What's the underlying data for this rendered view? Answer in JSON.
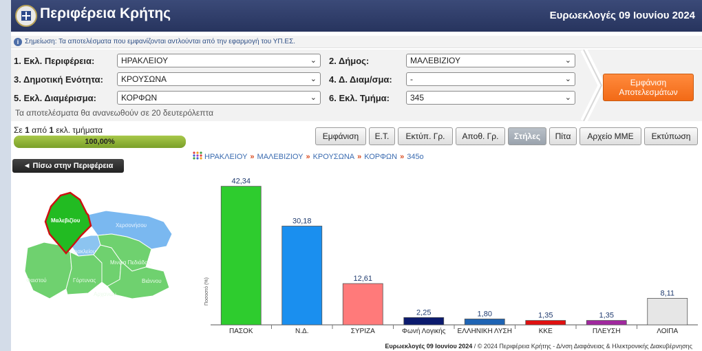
{
  "header": {
    "title": "Περιφέρεια Κρήτης",
    "election": "Ευρωεκλογές 09 Ιουνίου 2024"
  },
  "note": "Σημείωση: Τα αποτελέσματα που εμφανίζονται αντλούνται από την εφαρμογή του ΥΠ.ΕΣ.",
  "filters": [
    {
      "label": "1. Εκλ. Περιφέρεια:",
      "value": "ΗΡΑΚΛΕΙΟΥ"
    },
    {
      "label": "2. Δήμος:",
      "value": "ΜΑΛΕΒΙΖΙΟΥ"
    },
    {
      "label": "3. Δημοτική Ενότητα:",
      "value": "ΚΡΟΥΣΩΝΑ"
    },
    {
      "label": "4. Δ. Διαμ/σμα:",
      "value": "-"
    },
    {
      "label": "5. Εκλ. Διαμέρισμα:",
      "value": "ΚΟΡΦΩΝ"
    },
    {
      "label": "6. Εκλ. Τμήμα:",
      "value": "345"
    }
  ],
  "refresh_note": "Τα αποτελέσματα θα ανανεωθούν σε 20 δευτερόλεπτα",
  "show_results": {
    "line1": "Εμφάνιση",
    "line2": "Αποτελεσμάτων"
  },
  "progress": {
    "pre": "Σε ",
    "done": "1",
    "mid": " από ",
    "total": "1",
    "post": " εκλ. τμήματα",
    "percent_label": "100,00%",
    "fraction": 1.0
  },
  "toolbar": [
    {
      "label": "Εμφάνιση",
      "active": false
    },
    {
      "label": "Ε.Τ.",
      "active": false
    },
    {
      "label": "Εκτύπ. Γρ.",
      "active": false
    },
    {
      "label": "Αποθ. Γρ.",
      "active": false
    },
    {
      "label": "Στήλες",
      "active": true
    },
    {
      "label": "Πίτα",
      "active": false
    },
    {
      "label": "Αρχείο ΜΜΕ",
      "active": false
    },
    {
      "label": "Εκτύπωση",
      "active": false
    }
  ],
  "back_button": "◄ Πίσω στην Περιφέρεια",
  "breadcrumb": [
    "ΗΡΑΚΛΕΙΟΥ",
    "ΜΑΛΕΒΙΖΙΟΥ",
    "ΚΡΟΥΣΩΝΑ",
    "ΚΟΡΦΩΝ",
    "345ο"
  ],
  "map": {
    "selected": "Μαλεβιζίου",
    "regions": [
      "Χερσονήσου",
      "Ηρακλείου",
      "Μινώα Πεδιάδας",
      "Φαιστού",
      "Γόρτυνας",
      "Βιάννου",
      "Αρχανών"
    ],
    "colors": {
      "selected": "#22bb22",
      "selected_border": "#cc1111",
      "won": "#6fd16f",
      "other": "#7ab8f0"
    }
  },
  "chart_data": {
    "type": "bar",
    "ylabel": "Ποσοστό (%)",
    "categories": [
      "ΠΑΣΟΚ",
      "Ν.Δ.",
      "ΣΥΡΙΖΑ",
      "Φωνή Λογικής",
      "ΕΛΛΗΝΙΚΗ ΛΥΣΗ",
      "ΚΚΕ",
      "ΠΛΕΥΣΗ",
      "ΛΟΙΠΑ"
    ],
    "values": [
      42.34,
      30.18,
      12.61,
      2.25,
      1.8,
      1.35,
      1.35,
      8.11
    ],
    "value_labels": [
      "42,34",
      "30,18",
      "12,61",
      "2,25",
      "1,80",
      "1,35",
      "1,35",
      "8,11"
    ],
    "colors": [
      "#2ecc2e",
      "#1a8fef",
      "#ff7a7a",
      "#0b1a6e",
      "#1e64b4",
      "#e01010",
      "#a0289e",
      "#e6e6e6"
    ],
    "ylim": [
      0,
      45
    ]
  },
  "footer": {
    "bold": "Ευρωεκλογές 09 Ιουνίου 2024",
    "rest": " / © 2024 Περιφέρεια Κρήτης - Δ/νση Διαφάνειας & Ηλεκτρονικής Διακυβέρνησης"
  }
}
